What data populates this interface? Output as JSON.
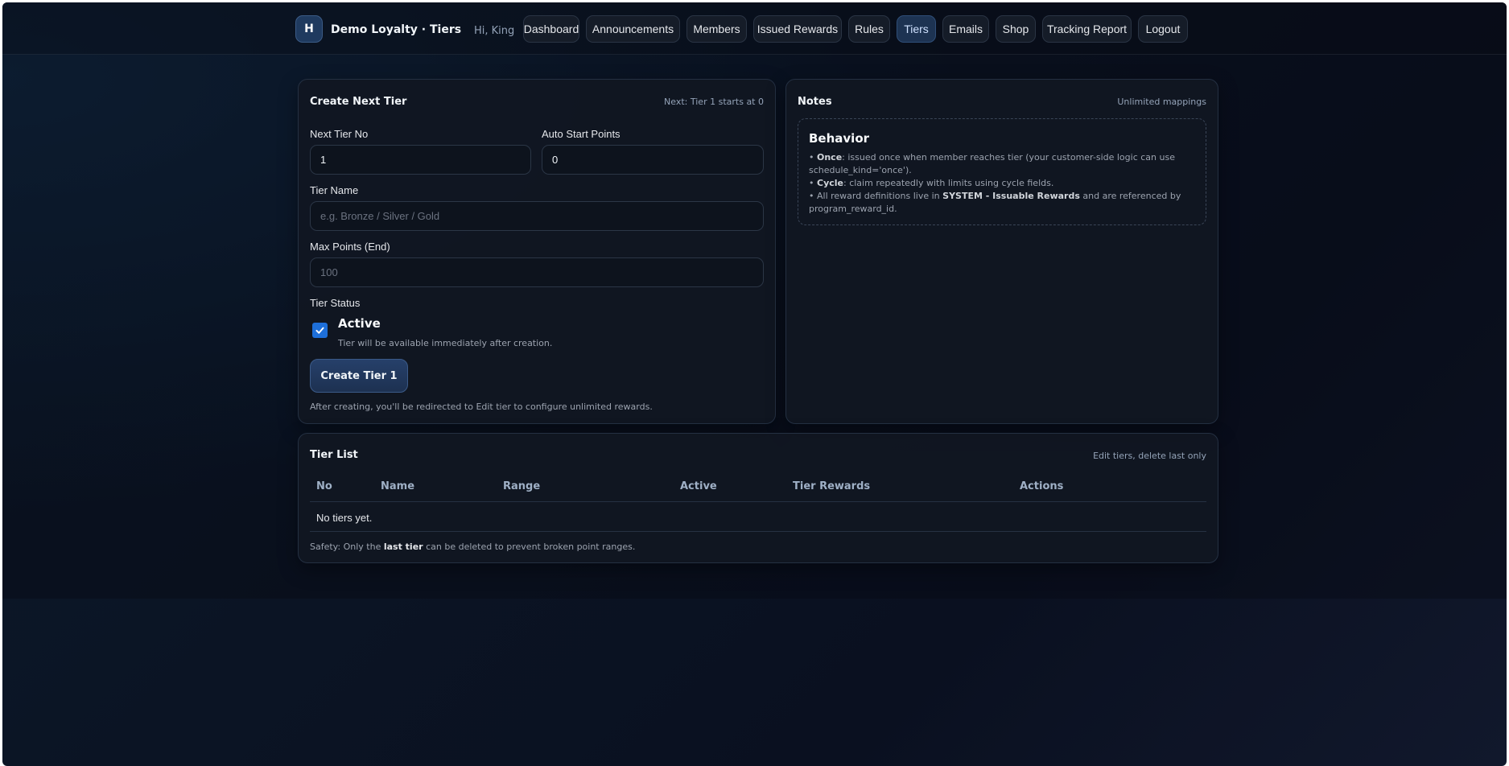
{
  "header": {
    "brand_initial": "H",
    "brand_title": "Demo Loyalty · Tiers",
    "greeting": "Hi, King",
    "nav": [
      "Dashboard",
      "Announcements",
      "Members",
      "Issued Rewards",
      "Rules",
      "Tiers",
      "Emails",
      "Shop",
      "Tracking Report",
      "Logout"
    ],
    "active_nav": "Tiers"
  },
  "create_card": {
    "title": "Create Next Tier",
    "meta": "Next: Tier 1 starts at 0",
    "next_tier_label": "Next Tier No",
    "next_tier_value": "1",
    "start_points_label": "Auto Start Points",
    "start_points_value": "0",
    "tier_name_label": "Tier Name",
    "tier_name_placeholder": "e.g. Bronze / Silver / Gold",
    "max_points_label": "Max Points (End)",
    "max_points_placeholder": "100",
    "status_label": "Tier Status",
    "active_checked": true,
    "active_label": "Active",
    "active_help": "Tier will be available immediately after creation.",
    "create_button": "Create Tier 1",
    "hint": "After creating, you'll be redirected to Edit tier to configure unlimited rewards."
  },
  "notes_card": {
    "title": "Notes",
    "meta": "Unlimited mappings",
    "behavior_title": "Behavior",
    "once_term": "Once",
    "once_text": ": issued once when member reaches tier (your customer-side logic can use schedule_kind='once').",
    "cycle_term": "Cycle",
    "cycle_text": ": claim repeatedly with limits using cycle fields.",
    "defs_pre": "• All reward definitions live in ",
    "defs_term": "SYSTEM - Issuable Rewards",
    "defs_post": " and are referenced by program_reward_id."
  },
  "tier_list": {
    "title": "Tier List",
    "meta": "Edit tiers, delete last only",
    "columns": [
      "No",
      "Name",
      "Range",
      "Active",
      "Tier Rewards",
      "Actions"
    ],
    "empty_text": "No tiers yet.",
    "safety_pre": "Safety: Only the ",
    "safety_term": "last tier",
    "safety_post": " can be deleted to prevent broken point ranges."
  },
  "colors": {
    "accent": "#1e6fd9",
    "active_nav_bg": "#1d3352",
    "card_bg": "#111722"
  },
  "icons": {
    "checkbox": "check-icon"
  }
}
